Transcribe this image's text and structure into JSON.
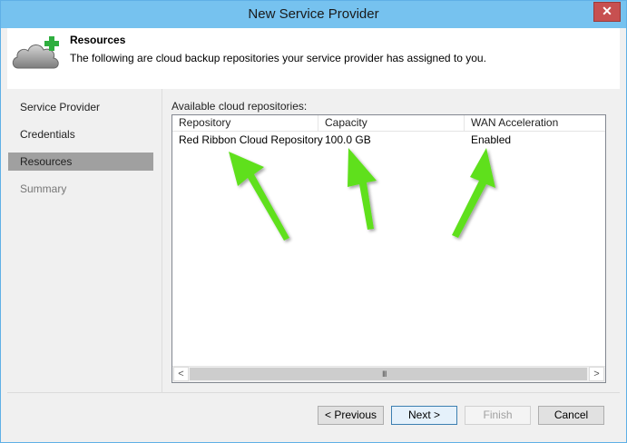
{
  "window": {
    "title": "New Service Provider",
    "close_glyph": "✕"
  },
  "header": {
    "title": "Resources",
    "description": "The following are cloud backup repositories your service provider has assigned to you.",
    "icon": "cloud-add-icon"
  },
  "nav": {
    "items": [
      {
        "label": "Service Provider",
        "state": "normal"
      },
      {
        "label": "Credentials",
        "state": "normal"
      },
      {
        "label": "Resources",
        "state": "selected"
      },
      {
        "label": "Summary",
        "state": "disabled"
      }
    ]
  },
  "repositories": {
    "label": "Available cloud repositories:",
    "columns": [
      "Repository",
      "Capacity",
      "WAN Acceleration"
    ],
    "rows": [
      {
        "repository": "Red Ribbon Cloud Repository",
        "capacity": "100.0 GB",
        "wan_acceleration": "Enabled"
      }
    ],
    "scroll_left": "<",
    "scroll_right": ">",
    "scroll_grip": "III"
  },
  "annotation": {
    "arrow_color": "#5ee01e",
    "icon": "green-arrow-icon"
  },
  "buttons": {
    "previous": "< Previous",
    "next": "Next >",
    "finish": "Finish",
    "cancel": "Cancel"
  },
  "colors": {
    "titlebar": "#76c2ef",
    "close": "#c75050",
    "nav_selected": "#a0a0a0"
  }
}
